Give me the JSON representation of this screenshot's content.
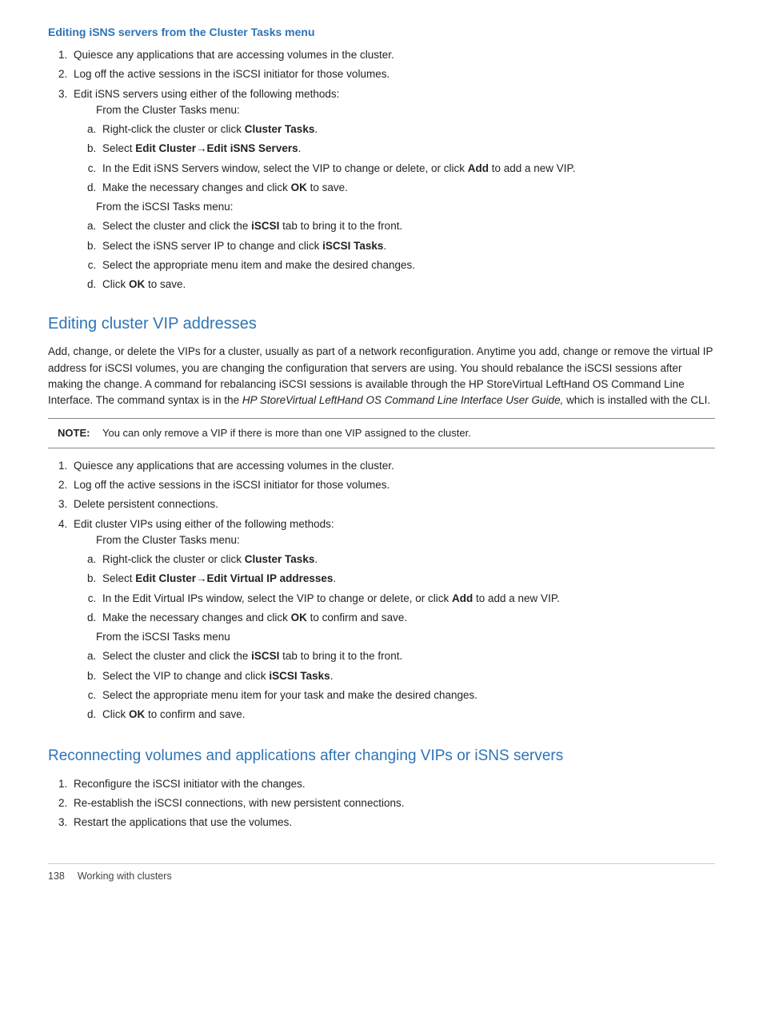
{
  "page": {
    "footer": {
      "page_number": "138",
      "section_label": "Working with clusters"
    }
  },
  "section1": {
    "heading": "Editing iSNS servers from the Cluster Tasks menu",
    "steps": [
      "Quiesce any applications that are accessing volumes in the cluster.",
      "Log off the active sessions in the iSCSI initiator for those volumes.",
      "Edit iSNS servers using either of the following methods:"
    ],
    "from_cluster_tasks_label": "From the Cluster Tasks menu:",
    "cluster_tasks_substeps": [
      "Right-click the cluster or click ",
      "Select ",
      "In the Edit iSNS Servers window, select the VIP to change or delete, or click ",
      "Make the necessary changes and click "
    ],
    "cluster_tasks_bold": [
      "Cluster Tasks",
      "Edit Cluster→Edit iSNS Servers",
      "Add",
      "OK"
    ],
    "cluster_tasks_suffix": [
      ".",
      ".",
      " to add a new VIP.",
      " to save."
    ],
    "from_iscsi_tasks_label": "From the iSCSI Tasks menu:",
    "iscsi_tasks_substeps": [
      "Select the cluster and click the ",
      "Select the iSNS server IP to change and click ",
      "Select the appropriate menu item and make the desired changes.",
      "Click "
    ],
    "iscsi_tasks_bold": [
      "iSCSI",
      "iSCSI Tasks",
      "",
      "OK"
    ],
    "iscsi_tasks_suffix": [
      " tab to bring it to the front.",
      ".",
      "",
      " to save."
    ]
  },
  "section2": {
    "heading": "Editing cluster VIP addresses",
    "body": "Add, change, or delete the VIPs for a cluster, usually as part of a network reconfiguration. Anytime you add, change or remove the virtual IP address for iSCSI volumes, you are changing the configuration that servers are using. You should rebalance the iSCSI sessions after making the change. A command for rebalancing iSCSI sessions is available through the HP StoreVirtual LeftHand OS Command Line Interface. The command syntax is in the ",
    "body_italic": "HP StoreVirtual LeftHand OS Command Line Interface User Guide,",
    "body_suffix": " which is installed with the CLI.",
    "note_label": "NOTE:",
    "note_text": "You can only remove a VIP if there is more than one VIP assigned to the cluster.",
    "steps": [
      "Quiesce any applications that are accessing volumes in the cluster.",
      "Log off the active sessions in the iSCSI initiator for those volumes.",
      "Delete persistent connections.",
      "Edit cluster VIPs using either of the following methods:"
    ],
    "from_cluster_tasks_label": "From the Cluster Tasks menu:",
    "cluster_tasks_substeps_pre": [
      "Right-click the cluster or click ",
      "Select ",
      "In the Edit Virtual IPs window, select the VIP to change or delete, or click ",
      "Make the necessary changes and click "
    ],
    "cluster_tasks_bold2": [
      "Cluster Tasks",
      "Edit Cluster→Edit Virtual IP addresses",
      "Add",
      "OK"
    ],
    "cluster_tasks_suffix2": [
      ".",
      ".",
      " to add a new VIP.",
      " to confirm and save."
    ],
    "from_iscsi_tasks_label2": "From the iSCSI Tasks menu",
    "iscsi_tasks_substeps2": [
      "Select the cluster and click the ",
      "Select the VIP to change and click ",
      "Select the appropriate menu item for your task and make the desired changes.",
      "Click "
    ],
    "iscsi_tasks_bold2": [
      "iSCSI",
      "iSCSI Tasks",
      "",
      "OK"
    ],
    "iscsi_tasks_suffix2": [
      " tab to bring it to the front.",
      ".",
      "",
      " to confirm and save."
    ]
  },
  "section3": {
    "heading": "Reconnecting volumes and applications after changing VIPs or iSNS servers",
    "steps": [
      "Reconfigure the iSCSI initiator with the changes.",
      "Re-establish the iSCSI connections, with new persistent connections.",
      "Restart the applications that use the volumes."
    ]
  }
}
